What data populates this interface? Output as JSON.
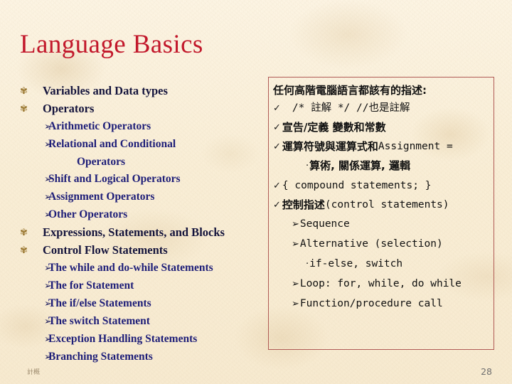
{
  "slide": {
    "title": "Language Basics",
    "background_color": "#faf0da",
    "title_color": "#c2182b",
    "page_number": "28",
    "footer_label": "計概"
  },
  "outline": {
    "bullet_glyph": "✾",
    "sub_bullet_glyph": "➢",
    "items": [
      {
        "level": 1,
        "label": "Variables and Data types"
      },
      {
        "level": 1,
        "label": "Operators"
      },
      {
        "level": 2,
        "label": "Arithmetic Operators"
      },
      {
        "level": 2,
        "label": "Relational and Conditional",
        "continuation": "Operators"
      },
      {
        "level": 2,
        "label": "Shift and Logical Operators"
      },
      {
        "level": 2,
        "label": "Assignment Operators"
      },
      {
        "level": 2,
        "label": "Other Operators"
      },
      {
        "level": 1,
        "label": "Expressions, Statements, and Blocks"
      },
      {
        "level": 1,
        "label": "Control Flow Statements"
      },
      {
        "level": 2,
        "label": "The while and do-while Statements"
      },
      {
        "level": 2,
        "label": "The for Statement"
      },
      {
        "level": 2,
        "label": "The if/else Statements"
      },
      {
        "level": 2,
        "label": "The switch Statement"
      },
      {
        "level": 2,
        "label": "Exception Handling Statements"
      },
      {
        "level": 2,
        "label": "Branching Statements"
      }
    ]
  },
  "panel": {
    "border_color": "#b05a55",
    "heading": "任何高階電腦語言都該有的指述:",
    "check_glyph": "✓",
    "arrow_glyph": "➢",
    "dot_glyph": "·",
    "rows": [
      {
        "marker": "check",
        "indent": 0,
        "text_cjk": "",
        "text_mono": "/* 註解 */     //也是註解",
        "gap": true
      },
      {
        "marker": "check",
        "indent": 0,
        "text_cjk": "宣告/定義 變數和常數",
        "text_mono": ""
      },
      {
        "marker": "check",
        "indent": 0,
        "text_cjk": "運算符號與運算式和",
        "text_mono": " Assignment ="
      },
      {
        "marker": "dot",
        "indent": 2,
        "text_cjk": "算術, 關係運算, 邏輯",
        "text_mono": ""
      },
      {
        "marker": "check",
        "indent": 0,
        "text_cjk": "",
        "text_mono": "{ compound statements; }"
      },
      {
        "marker": "check",
        "indent": 0,
        "text_cjk": "控制指述",
        "text_mono": "(control statements)"
      },
      {
        "marker": "arrow",
        "indent": 1,
        "text_cjk": "",
        "text_mono": "Sequence"
      },
      {
        "marker": "arrow",
        "indent": 1,
        "text_cjk": "",
        "text_mono": "Alternative (selection)"
      },
      {
        "marker": "dot",
        "indent": 2,
        "text_cjk": "",
        "text_mono": "if-else, switch"
      },
      {
        "marker": "arrow",
        "indent": 1,
        "text_cjk": "",
        "text_mono": "Loop: for, while, do while"
      },
      {
        "marker": "arrow",
        "indent": 1,
        "text_cjk": "",
        "text_mono": "Function/procedure call"
      }
    ]
  }
}
